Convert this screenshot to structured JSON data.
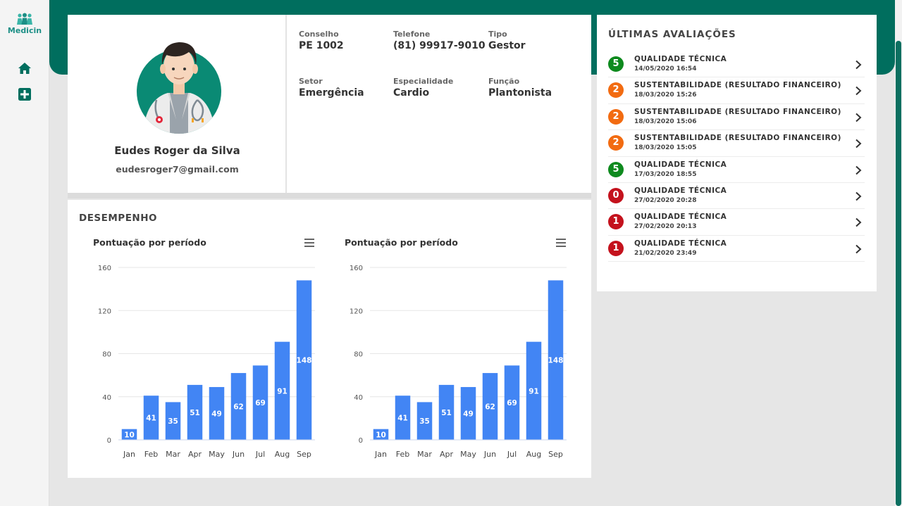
{
  "app": {
    "logo_text": "Medicin"
  },
  "profile": {
    "name": "Eudes Roger da Silva",
    "email": "eudesroger7@gmail.com",
    "fields": [
      {
        "label": "Conselho",
        "value": "PE 1002"
      },
      {
        "label": "Telefone",
        "value": "(81) 99917-9010"
      },
      {
        "label": "Tipo",
        "value": "Gestor"
      },
      {
        "label": "Setor",
        "value": "Emergência"
      },
      {
        "label": "Especialidade",
        "value": "Cardio"
      },
      {
        "label": "Função",
        "value": "Plantonista"
      }
    ]
  },
  "performance": {
    "title": "DESEMPENHO",
    "charts": [
      {
        "title": "Pontuação por período"
      },
      {
        "title": "Pontuação por período"
      }
    ]
  },
  "chart_data": [
    {
      "type": "bar",
      "title": "Pontuação por período",
      "categories": [
        "Jan",
        "Feb",
        "Mar",
        "Apr",
        "May",
        "Jun",
        "Jul",
        "Aug",
        "Sep"
      ],
      "values": [
        10,
        41,
        35,
        51,
        49,
        62,
        69,
        91,
        148
      ],
      "ylim": [
        0,
        160
      ],
      "yticks": [
        0,
        40,
        80,
        120,
        160
      ],
      "grid": true,
      "color": "#4285f4"
    },
    {
      "type": "bar",
      "title": "Pontuação por período",
      "categories": [
        "Jan",
        "Feb",
        "Mar",
        "Apr",
        "May",
        "Jun",
        "Jul",
        "Aug",
        "Sep"
      ],
      "values": [
        10,
        41,
        35,
        51,
        49,
        62,
        69,
        91,
        148
      ],
      "ylim": [
        0,
        160
      ],
      "yticks": [
        0,
        40,
        80,
        120,
        160
      ],
      "grid": true,
      "color": "#4285f4"
    }
  ],
  "evaluations": {
    "title": "ÚLTIMAS AVALIAÇÕES",
    "items": [
      {
        "score": "5",
        "name": "QUALIDADE TÉCNICA",
        "date": "14/05/2020 16:54",
        "color": "#0e8a1e"
      },
      {
        "score": "2",
        "name": "SUSTENTABILIDADE (RESULTADO FINANCEIRO)",
        "date": "18/03/2020 15:26",
        "color": "#f26b11"
      },
      {
        "score": "2",
        "name": "SUSTENTABILIDADE (RESULTADO FINANCEIRO)",
        "date": "18/03/2020 15:06",
        "color": "#f26b11"
      },
      {
        "score": "2",
        "name": "SUSTENTABILIDADE (RESULTADO FINANCEIRO)",
        "date": "18/03/2020 15:05",
        "color": "#f26b11"
      },
      {
        "score": "5",
        "name": "QUALIDADE TÉCNICA",
        "date": "17/03/2020 18:55",
        "color": "#0e8a1e"
      },
      {
        "score": "0",
        "name": "QUALIDADE TÉCNICA",
        "date": "27/02/2020 20:28",
        "color": "#c4121d"
      },
      {
        "score": "1",
        "name": "QUALIDADE TÉCNICA",
        "date": "27/02/2020 20:13",
        "color": "#c4121d"
      },
      {
        "score": "1",
        "name": "QUALIDADE TÉCNICA",
        "date": "21/02/2020 23:49",
        "color": "#c4121d"
      }
    ]
  },
  "icons": {
    "logo": "people-group-icon",
    "nav_home": "home-icon",
    "nav_add": "medical-plus-icon",
    "chart_menu": "hamburger-menu-icon",
    "eval_arrow": "chevron-right-icon"
  },
  "colors": {
    "brand": "#006e5e",
    "brand_light": "#1c8f86",
    "bar": "#4285f4"
  }
}
